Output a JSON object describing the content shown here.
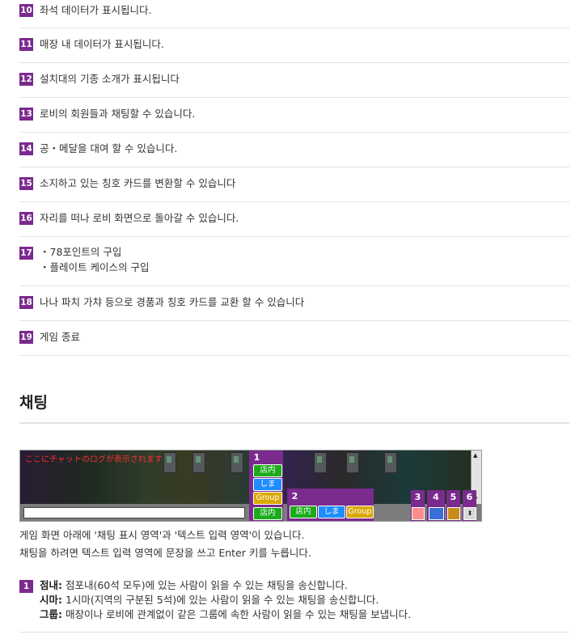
{
  "feature_list": [
    {
      "num": "10",
      "text": "좌석 데이터가 표시됩니다."
    },
    {
      "num": "11",
      "text": "매장 내 데이터가 표시됩니다."
    },
    {
      "num": "12",
      "text": "설치대의 기종 소개가 표시됩니다"
    },
    {
      "num": "13",
      "text": "로비의 회원들과 채팅할 수 있습니다."
    },
    {
      "num": "14",
      "text": "공・메달을 대여 할 수 있습니다."
    },
    {
      "num": "15",
      "text": "소지하고 있는 칭호 카드를 변환할 수 있습니다"
    },
    {
      "num": "16",
      "text": "자리를 떠나 로비 화면으로 돌아갈 수 있습니다."
    },
    {
      "num": "17",
      "line1": "・78포인트의 구입",
      "line2": "・플레이트 케이스의 구입"
    },
    {
      "num": "18",
      "text": "나나 파치 가챠 등으로 경품과 칭호 카드를 교환 할 수 있습니다"
    },
    {
      "num": "19",
      "text": "게임 종료"
    }
  ],
  "section": {
    "title": "채팅"
  },
  "game": {
    "chat_log_placeholder": "ここにチャットのログが表示されます",
    "buttons": {
      "store": "店内",
      "island": "しま",
      "group": "Group",
      "store2": "店内"
    },
    "callouts": [
      "1",
      "2",
      "3",
      "4",
      "5",
      "6"
    ]
  },
  "description": {
    "line1": "게임 화면 아래에 '채팅 표시 영역'과 '텍스트 입력 영역'이 있습니다.",
    "line2": "채팅을 하려면 텍스트 입력 영역에 문장을 쓰고 Enter 키를 누릅니다."
  },
  "detail": {
    "num": "1",
    "items": [
      {
        "label": "점내:",
        "text": " 점포내(60석 모두)에 있는 사람이 읽을 수 있는 채팅을 송신합니다."
      },
      {
        "label": "시마:",
        "text": " 1시마(지역의 구분된 5석)에 있는 사람이 읽을 수 있는 채팅을 송신합니다."
      },
      {
        "label": "그룹:",
        "text": " 매장이나 로비에 관계없이 같은 그룹에 속한 사람이 읽을 수 있는 채팅을 보냅니다."
      }
    ]
  },
  "colors": {
    "accent": "#7b2a8e",
    "border": "#e2e2e2"
  }
}
